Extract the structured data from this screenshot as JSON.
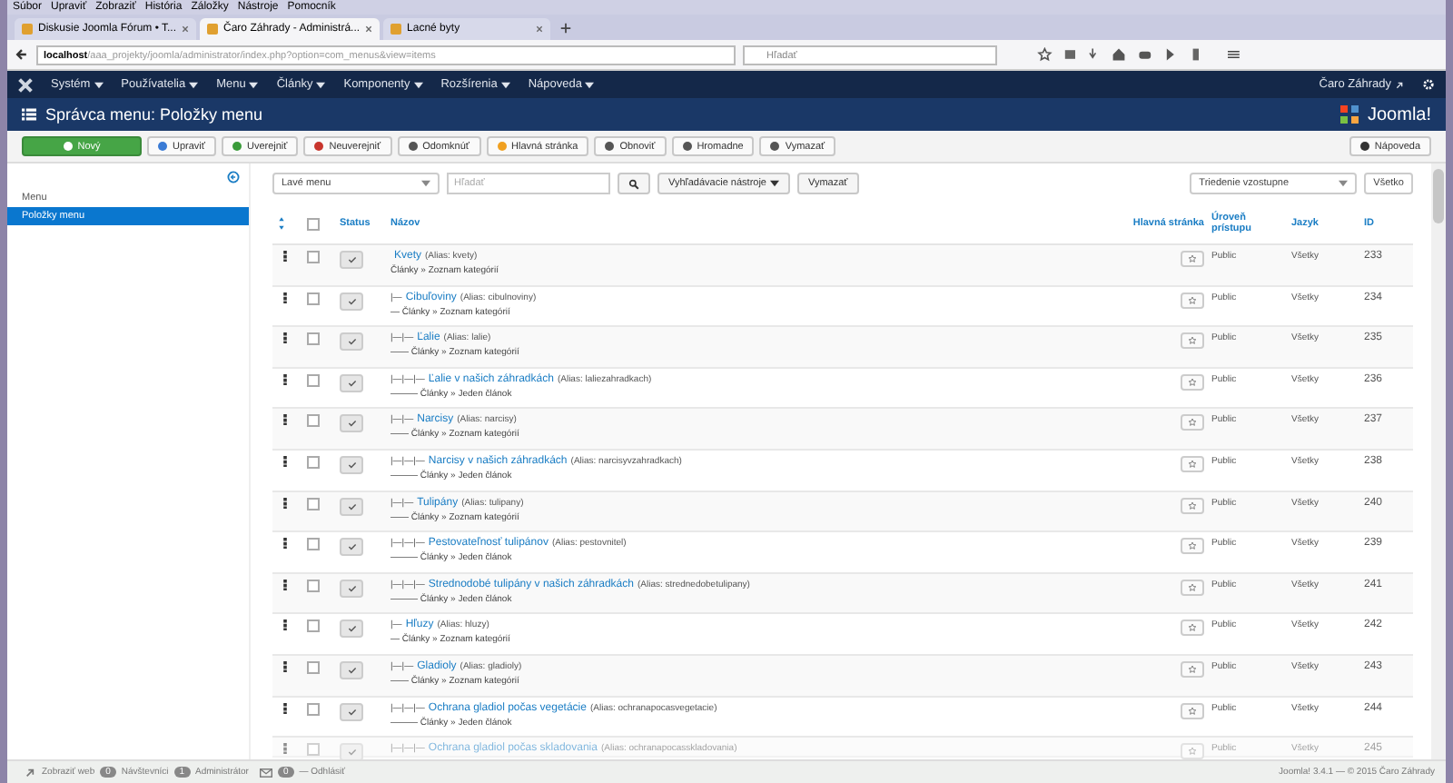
{
  "browser": {
    "menu": [
      "Súbor",
      "Upraviť",
      "Zobraziť",
      "História",
      "Záložky",
      "Nástroje",
      "Pomocník"
    ],
    "tabs": [
      {
        "title": "Diskusie Joomla Fórum • T...",
        "selected": false
      },
      {
        "title": "Čaro Záhrady - Administrá...",
        "selected": true
      },
      {
        "title": "Lacné byty",
        "selected": false
      }
    ],
    "url_host": "localhost",
    "url_path": "/aaa_projekty/joomla/administrator/index.php?option=com_menus&view=items",
    "search_placeholder": "Hľadať"
  },
  "nav": {
    "items": [
      "Systém",
      "Používatelia",
      "Menu",
      "Články",
      "Komponenty",
      "Rozšírenia",
      "Nápoveda"
    ],
    "user": "Čaro Záhrady"
  },
  "header": {
    "title": "Správca menu: Položky menu",
    "logo": "Joomla!"
  },
  "toolbar": {
    "buttons": [
      {
        "label": "Nový",
        "kind": "new"
      },
      {
        "label": "Upraviť",
        "kind": "edit"
      },
      {
        "label": "Uverejniť",
        "kind": "publish"
      },
      {
        "label": "Neuverejniť",
        "kind": "unpublish"
      },
      {
        "label": "Odomknúť",
        "kind": "checkin"
      },
      {
        "label": "Hlavná stránka",
        "kind": "home"
      },
      {
        "label": "Obnoviť",
        "kind": "refresh"
      },
      {
        "label": "Hromadne",
        "kind": "batch"
      },
      {
        "label": "Vymazať",
        "kind": "delete"
      }
    ],
    "help": "Nápoveda"
  },
  "sidebar": {
    "items": [
      {
        "label": "Menu",
        "selected": false
      },
      {
        "label": "Položky menu",
        "selected": true
      }
    ]
  },
  "filters": {
    "menu": "Lavé menu",
    "search_placeholder": "Hľadať",
    "tools": "Vyhľadávacie nástroje",
    "clear": "Vymazať",
    "ordering": "Triedenie vzostupne",
    "limit": "Všetko"
  },
  "table": {
    "select_all_checked": false,
    "columns": [
      "Status",
      "Názov",
      "Hlavná stránka",
      "Úroveň prístupu",
      "Jazyk",
      "ID"
    ],
    "rows": [
      {
        "prefix": "",
        "title": "Kvety",
        "alias": "(Alias: kvety)",
        "link": "Články » Zoznam kategórií",
        "access": "Public",
        "language": "Všetky",
        "id": "233",
        "checked": false,
        "published": true
      },
      {
        "prefix": "|—",
        "title": "Cibuľoviny",
        "alias": "(Alias: cibulnoviny)",
        "link": "— Články » Zoznam kategórií",
        "access": "Public",
        "language": "Všetky",
        "id": "234",
        "checked": false,
        "published": true
      },
      {
        "prefix": "|—|—",
        "title": "Ľalie",
        "alias": "(Alias: lalie)",
        "link": "—— Články » Zoznam kategórií",
        "access": "Public",
        "language": "Všetky",
        "id": "235",
        "checked": false,
        "published": true
      },
      {
        "prefix": "|—|—|—",
        "title": "Ľalie v našich záhradkách",
        "alias": "(Alias: laliezahradkach)",
        "link": "——— Články » Jeden článok",
        "access": "Public",
        "language": "Všetky",
        "id": "236",
        "checked": false,
        "published": true
      },
      {
        "prefix": "|—|—",
        "title": "Narcisy",
        "alias": "(Alias: narcisy)",
        "link": "—— Články » Zoznam kategórií",
        "access": "Public",
        "language": "Všetky",
        "id": "237",
        "checked": false,
        "published": true
      },
      {
        "prefix": "|—|—|—",
        "title": "Narcisy v našich záhradkách",
        "alias": "(Alias: narcisyvzahradkach)",
        "link": "——— Články » Jeden článok",
        "access": "Public",
        "language": "Všetky",
        "id": "238",
        "checked": false,
        "published": true
      },
      {
        "prefix": "|—|—",
        "title": "Tulipány",
        "alias": "(Alias: tulipany)",
        "link": "—— Články » Zoznam kategórií",
        "access": "Public",
        "language": "Všetky",
        "id": "240",
        "checked": false,
        "published": true
      },
      {
        "prefix": "|—|—|—",
        "title": "Pestovateľnosť tulipánov",
        "alias": "(Alias: pestovnitel)",
        "link": "——— Články » Jeden článok",
        "access": "Public",
        "language": "Všetky",
        "id": "239",
        "checked": false,
        "published": true
      },
      {
        "prefix": "|—|—|—",
        "title": "Strednodobé tulipány v našich záhradkách",
        "alias": "(Alias: strednedobetulipany)",
        "link": "——— Články » Jeden článok",
        "access": "Public",
        "language": "Všetky",
        "id": "241",
        "checked": false,
        "published": true
      },
      {
        "prefix": "|—",
        "title": "Hľuzy",
        "alias": "(Alias: hluzy)",
        "link": "— Články » Zoznam kategórií",
        "access": "Public",
        "language": "Všetky",
        "id": "242",
        "checked": false,
        "published": true
      },
      {
        "prefix": "|—|—",
        "title": "Gladioly",
        "alias": "(Alias: gladioly)",
        "link": "—— Články » Zoznam kategórií",
        "access": "Public",
        "language": "Všetky",
        "id": "243",
        "checked": false,
        "published": true
      },
      {
        "prefix": "|—|—|—",
        "title": "Ochrana gladiol počas vegetácie",
        "alias": "(Alias: ochranapocasvegetacie)",
        "link": "——— Články » Jeden článok",
        "access": "Public",
        "language": "Všetky",
        "id": "244",
        "checked": false,
        "published": true
      },
      {
        "prefix": "|—|—|—",
        "title": "Ochrana gladiol počas skladovania",
        "alias": "(Alias: ochranapocasskladovania)",
        "access": "Public",
        "language": "Všetky",
        "id": "245",
        "checked": false,
        "published": true
      }
    ]
  },
  "status_bar": {
    "site": "Zobraziť web",
    "visitors_count": "0",
    "visitors": "Návštevníci",
    "admins_count": "1",
    "admins": "Administrátor",
    "messages_count": "0",
    "logout": "— Odhlásiť",
    "version": "Joomla! 3.4.1 — © 2015 Čaro Záhrady"
  }
}
